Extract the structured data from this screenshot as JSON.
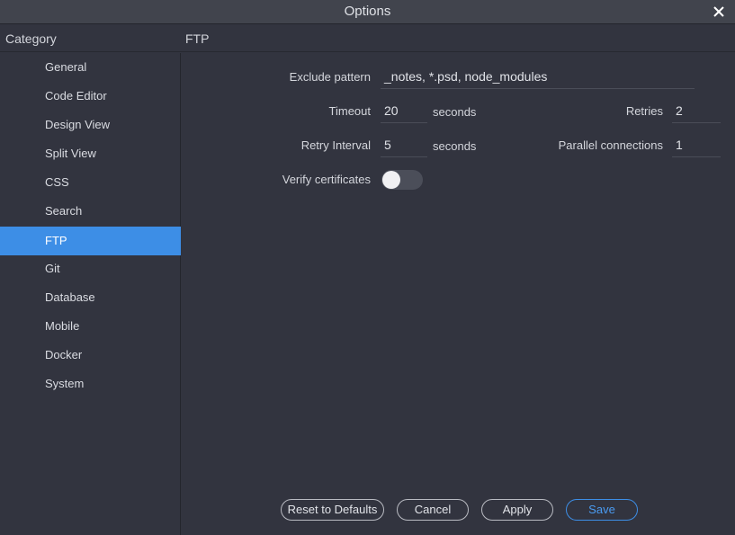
{
  "window": {
    "title": "Options"
  },
  "header": {
    "category_label": "Category",
    "section_title": "FTP"
  },
  "sidebar": {
    "items": [
      {
        "label": "General"
      },
      {
        "label": "Code Editor"
      },
      {
        "label": "Design View"
      },
      {
        "label": "Split View"
      },
      {
        "label": "CSS"
      },
      {
        "label": "Search"
      },
      {
        "label": "FTP",
        "selected": true
      },
      {
        "label": "Git"
      },
      {
        "label": "Database"
      },
      {
        "label": "Mobile"
      },
      {
        "label": "Docker"
      },
      {
        "label": "System"
      }
    ]
  },
  "form": {
    "exclude_pattern": {
      "label": "Exclude pattern",
      "value": "_notes, *.psd, node_modules"
    },
    "timeout": {
      "label": "Timeout",
      "value": "20",
      "unit": "seconds"
    },
    "retries": {
      "label": "Retries",
      "value": "2"
    },
    "retry_interval": {
      "label": "Retry Interval",
      "value": "5",
      "unit": "seconds"
    },
    "parallel_connections": {
      "label": "Parallel connections",
      "value": "1"
    },
    "verify_certificates": {
      "label": "Verify certificates",
      "enabled": false
    }
  },
  "buttons": {
    "reset": "Reset to Defaults",
    "cancel": "Cancel",
    "apply": "Apply",
    "save": "Save"
  },
  "colors": {
    "background": "#32343f",
    "titlebar": "#41444d",
    "selection": "#3d8ee6",
    "primary_button": "#3d8ee6"
  }
}
